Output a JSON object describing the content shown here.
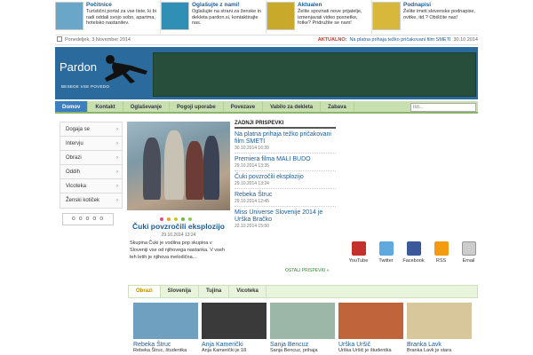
{
  "promos": [
    {
      "title": "Počitnice",
      "desc": "Turistični portal za vse tiste, ki bi radi oddali svojo sobo, apartma, hotelsko nastanitev.",
      "thumb_color": "#6aa6c8"
    },
    {
      "title": "Oglašujte z nami!",
      "desc": "Oglašujte na strani za ženske in dekleta pardon.si, kontaktirajte nas.",
      "thumb_color": "#2f8fb4"
    },
    {
      "title": "Aktualen",
      "desc": "Želite spoznati nove prijatelje, izmenjavati video posnetke, fotke? Pridružite se nam!",
      "thumb_color": "#c9a92a"
    },
    {
      "title": "Podnapisi",
      "desc": "Želite imeti slovenske podnapise, ovitke, itd.? Obiščite nas!",
      "thumb_color": "#d8b83a"
    }
  ],
  "date_bar": {
    "date": "Ponedeljek, 3 November 2014",
    "label": "AKTUALNO:",
    "news": "Na platna prihaja težko pričakovani film SMETI",
    "news_date": "30.10.2014"
  },
  "header": {
    "logo": "Pardon",
    "tagline": "BESEDE VSE POVEDO"
  },
  "nav": {
    "items": [
      "Domov",
      "Kontakt",
      "Oglaševanje",
      "Pogoji uporabe",
      "Povezave",
      "Vabilo za dekleta",
      "Zabava"
    ],
    "search_placeholder": "Išči..."
  },
  "sidebar": {
    "items": [
      "Dogaja se",
      "Intervju",
      "Obrazi",
      "Oddih",
      "Vicoteka",
      "Ženski kotiček"
    ],
    "logo_text": "o o o o o"
  },
  "feature": {
    "title": "Čuki povzročili eksplozijo",
    "date": "29.10.2014 13:24",
    "text": "Skupina Čuki je vodilna pop skupina v Sloveniji vse od njihovega nastanka. V vseh teh letih je njihova melodična..."
  },
  "latest": {
    "heading": "ZADNJI PRISPEVKI",
    "posts": [
      {
        "title": "Na platna prihaja težko pričakovani film SMETI",
        "date": "30.10.2014 16:39"
      },
      {
        "title": "Premiera filma MALI BUDO",
        "date": "29.10.2014 13:35"
      },
      {
        "title": "Čuki povzročili eksplozijo",
        "date": "29.10.2014 13:24"
      },
      {
        "title": "Rebeka Štruc",
        "date": "29.10.2014 12:45"
      },
      {
        "title": "Miss Universe Slovenije 2014 je Urška Bračko",
        "date": "22.10.2014 15:50"
      }
    ],
    "more": "OSTALI PRISPEVKI »"
  },
  "social": [
    {
      "label": "YouTube",
      "icon": "youtube-icon",
      "color": "#c4302b"
    },
    {
      "label": "Twitter",
      "icon": "twitter-icon",
      "color": "#5ea9dd"
    },
    {
      "label": "Facebook",
      "icon": "facebook-icon",
      "color": "#3b5998"
    },
    {
      "label": "RSS",
      "icon": "rss-icon",
      "color": "#f39c12"
    },
    {
      "label": "Email",
      "icon": "email-icon",
      "color": "#cccccc"
    }
  ],
  "tabs": [
    "Obrazi",
    "Slovenija",
    "Tujina",
    "Vicoteka"
  ],
  "gallery": [
    {
      "name": "Rebeka Štruc",
      "desc": "Rebeka Štruc, študentka",
      "color": "#6fa0c0"
    },
    {
      "name": "Anja Kamerički",
      "desc": "Anja Kamerički je 18",
      "color": "#3a3a3a"
    },
    {
      "name": "Sanja Bencuz",
      "desc": "Sanja Bencuz, prihaja",
      "color": "#9cb7a8"
    },
    {
      "name": "Urška Uršič",
      "desc": "Urška Uršič je študentka",
      "color": "#c0643c"
    },
    {
      "name": "Branka Lavk",
      "desc": "Branka Lavk je stara",
      "color": "#d7c79a"
    }
  ]
}
